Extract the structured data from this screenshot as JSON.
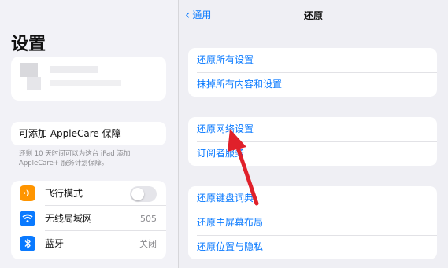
{
  "sidebar": {
    "title": "设置",
    "applecare": {
      "label": "可添加 AppleCare 保障",
      "note": "还剩 10 天时间可以为这台 iPad 添加 AppleCare+ 服务计划保障。"
    },
    "items": [
      {
        "label": "飞行模式",
        "icon": "airplane-icon",
        "icon_color": "#ff9500",
        "toggle_on": false
      },
      {
        "label": "无线局域网",
        "icon": "wifi-icon",
        "icon_color": "#0a7aff",
        "value": "505"
      },
      {
        "label": "蓝牙",
        "icon": "bluetooth-icon",
        "icon_color": "#0a7aff",
        "value": "关闭"
      }
    ]
  },
  "navbar": {
    "back_label": "通用",
    "title": "还原"
  },
  "groups": [
    {
      "rows": [
        "还原所有设置",
        "抹掉所有内容和设置"
      ]
    },
    {
      "rows": [
        "还原网络设置",
        "订阅者服务"
      ]
    },
    {
      "rows": [
        "还原键盘词典",
        "还原主屏幕布局",
        "还原位置与隐私"
      ]
    }
  ],
  "colors": {
    "accent": "#0a7aff",
    "arrow": "#e0202a",
    "airplane": "#ff9500"
  }
}
